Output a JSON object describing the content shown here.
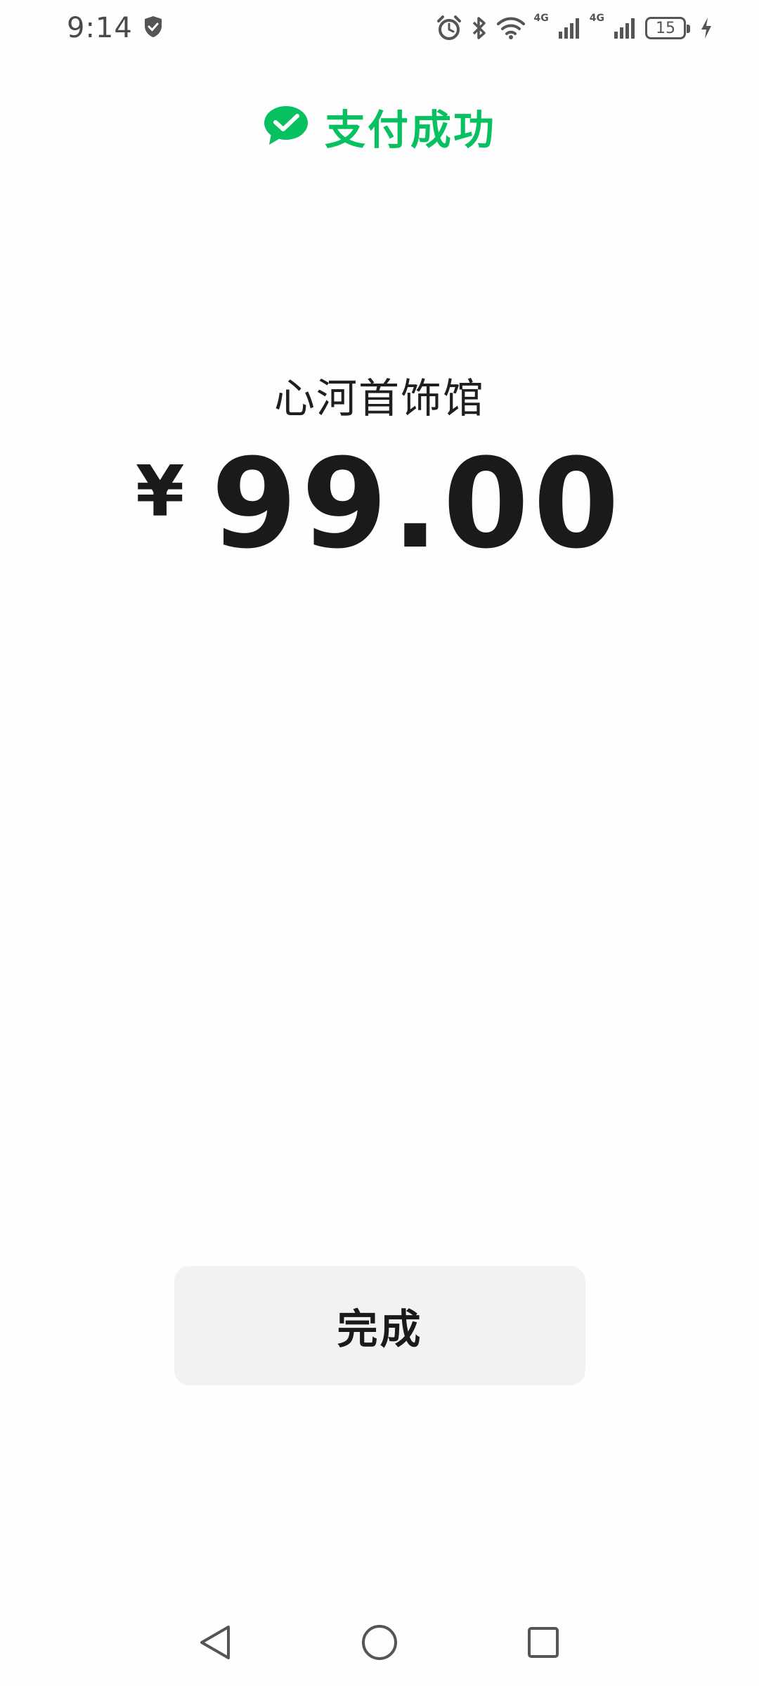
{
  "status_bar": {
    "time": "9:14",
    "network_1": "4G",
    "network_2": "4G",
    "battery": "15"
  },
  "header": {
    "title": "支付成功",
    "icon": "wechat-pay-icon",
    "accent_color": "#07c160"
  },
  "payment": {
    "merchant": "心河首饰馆",
    "currency_symbol": "¥",
    "amount": "99.00"
  },
  "actions": {
    "done_label": "完成"
  },
  "nav": {
    "back_icon": "back-triangle-icon",
    "home_icon": "home-circle-icon",
    "recents_icon": "recents-square-icon"
  }
}
